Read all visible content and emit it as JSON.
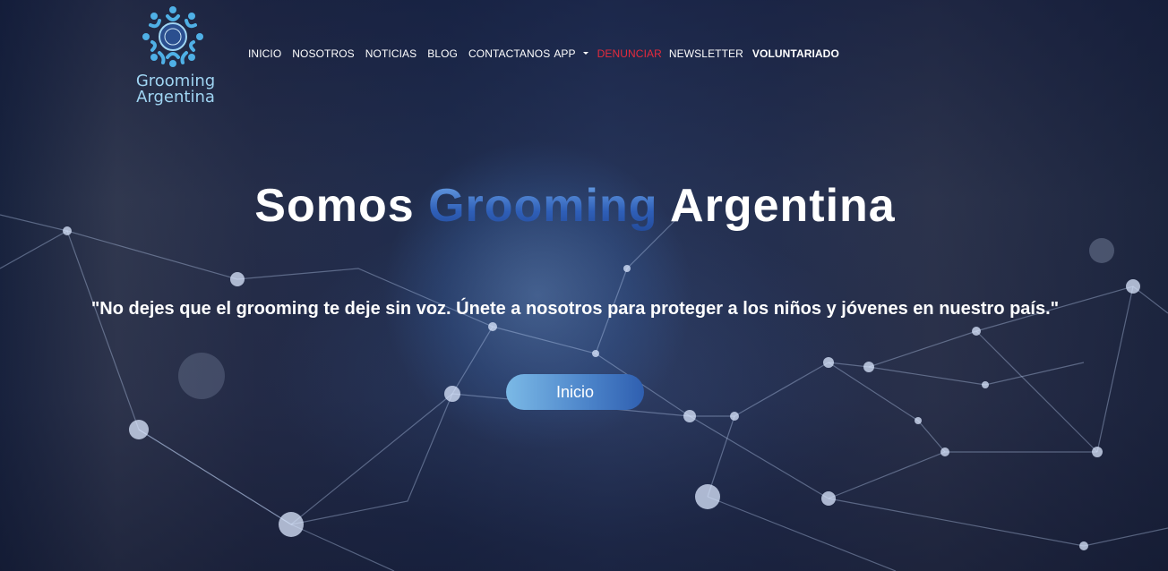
{
  "brand": {
    "logo_line1": "Grooming",
    "logo_line2": "Argentina",
    "logo_icon": "children-circle-globe-icon"
  },
  "nav": {
    "items": [
      {
        "label": "INICIO"
      },
      {
        "label": "NOSOTROS"
      },
      {
        "label": "NOTICIAS"
      },
      {
        "label": "BLOG"
      },
      {
        "label": "CONTACTANOS"
      },
      {
        "label": "APP"
      },
      {
        "label": "DENUNCIAR"
      },
      {
        "label": "NEWSLETTER"
      },
      {
        "label": "VOLUNTARIADO"
      }
    ]
  },
  "hero": {
    "headline_part1": "Somos",
    "headline_accent": "Grooming",
    "headline_part2": "Argentina",
    "tagline": "\"No dejes que el grooming te deje sin voz. Únete a nosotros para proteger a los niños y jóvenes en nuestro país.\"",
    "cta_label": "Inicio"
  },
  "colors": {
    "accent_blue": "#3a70c6",
    "denunciar_red": "#e62a3c",
    "logo_text": "#9fd4f2"
  }
}
